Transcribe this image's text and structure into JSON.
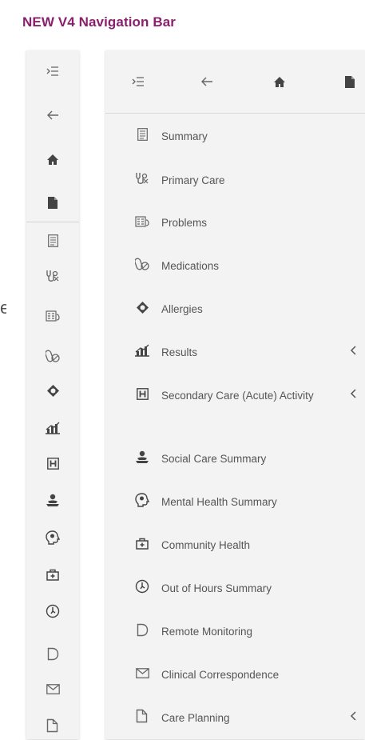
{
  "page": {
    "title": "NEW V4 Navigation Bar",
    "stray_letter": "e"
  },
  "colors": {
    "title": "#8a1f6e",
    "panel_bg": "#f3f3f3",
    "icon": "#666666",
    "text": "#555555"
  },
  "rail": {
    "icons": [
      "collapse-icon",
      "back-arrow-icon",
      "home-icon",
      "document-icon",
      "summary-icon",
      "stethoscope-icon",
      "problems-icon",
      "pills-icon",
      "allergy-icon",
      "results-chart-icon",
      "hospital-icon",
      "social-care-icon",
      "brain-icon",
      "community-medkit-icon",
      "clock-hours-icon",
      "remote-d-icon",
      "envelope-icon",
      "care-plan-doc-icon"
    ]
  },
  "toolbar": {
    "icons": [
      "collapse-icon",
      "back-arrow-icon",
      "home-icon",
      "document-icon"
    ]
  },
  "nav": {
    "items": [
      {
        "label": "Summary",
        "icon": "summary-icon",
        "expandable": false
      },
      {
        "label": "Primary Care",
        "icon": "stethoscope-icon",
        "expandable": false
      },
      {
        "label": "Problems",
        "icon": "problems-icon",
        "expandable": false
      },
      {
        "label": "Medications",
        "icon": "pills-icon",
        "expandable": false
      },
      {
        "label": "Allergies",
        "icon": "allergy-icon",
        "expandable": false
      },
      {
        "label": "Results",
        "icon": "results-chart-icon",
        "expandable": true,
        "chevron": "<"
      },
      {
        "label": "Secondary Care (Acute) Activity",
        "icon": "hospital-icon",
        "expandable": true,
        "chevron": "<"
      },
      {
        "label": "Social Care Summary",
        "icon": "social-care-icon",
        "expandable": false
      },
      {
        "label": "Mental Health Summary",
        "icon": "brain-icon",
        "expandable": false
      },
      {
        "label": "Community Health",
        "icon": "community-medkit-icon",
        "expandable": false
      },
      {
        "label": "Out of Hours Summary",
        "icon": "clock-hours-icon",
        "expandable": false
      },
      {
        "label": "Remote Monitoring",
        "icon": "remote-d-icon",
        "expandable": false
      },
      {
        "label": "Clinical Correspondence",
        "icon": "envelope-icon",
        "expandable": false
      },
      {
        "label": "Care Planning",
        "icon": "care-plan-doc-icon",
        "expandable": true,
        "chevron": "<"
      }
    ]
  }
}
